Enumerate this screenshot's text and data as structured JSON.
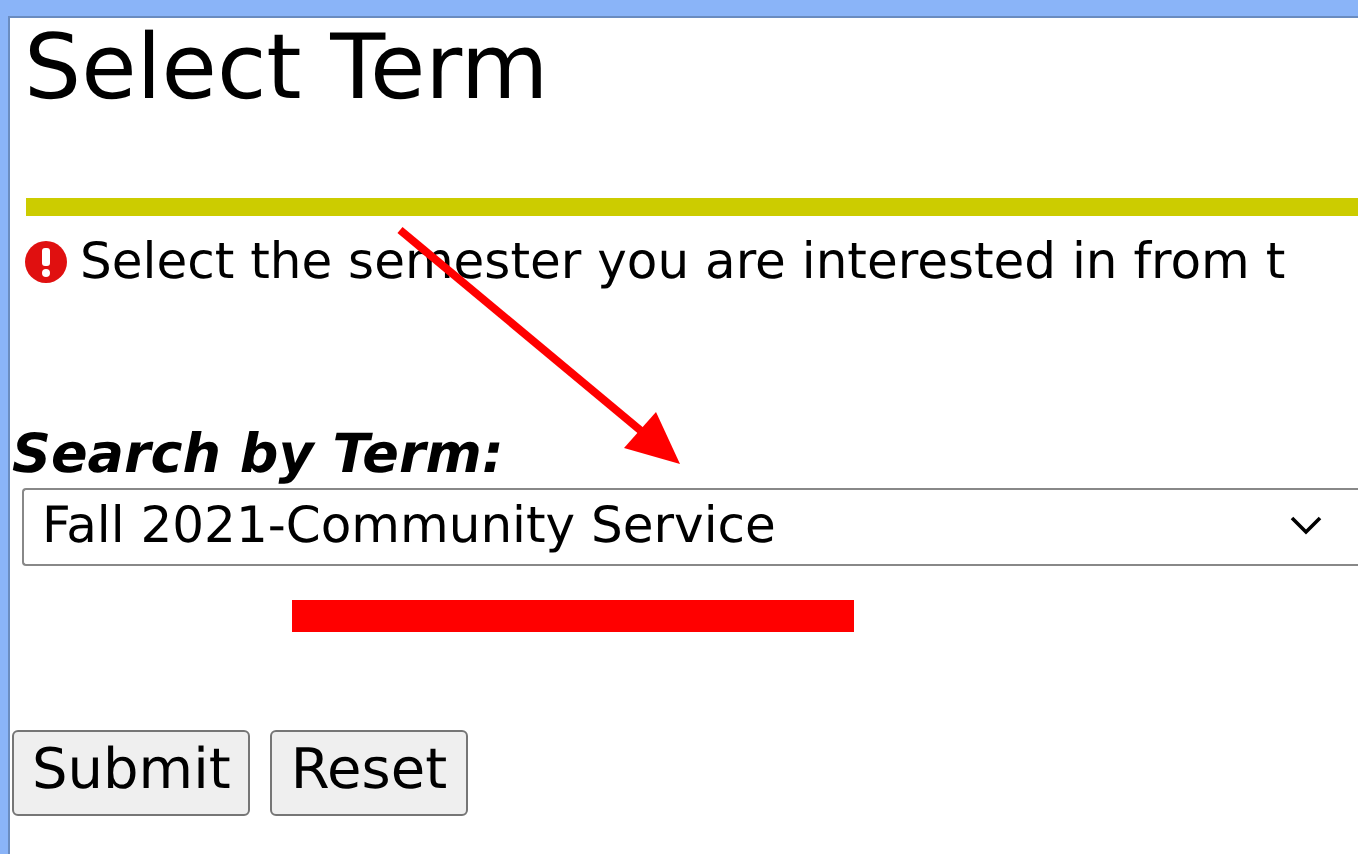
{
  "page": {
    "title": "Select Term"
  },
  "message": {
    "kind": "error",
    "text": "Select the semester you are interested in from t"
  },
  "search": {
    "label": "Search by Term:",
    "value": "Fall 2021-Community Service"
  },
  "buttons": [
    "Submit",
    "Reset"
  ],
  "annotations": {
    "arrow": {
      "color": "#ff0000"
    },
    "underline": {
      "color": "#ff0000"
    }
  }
}
